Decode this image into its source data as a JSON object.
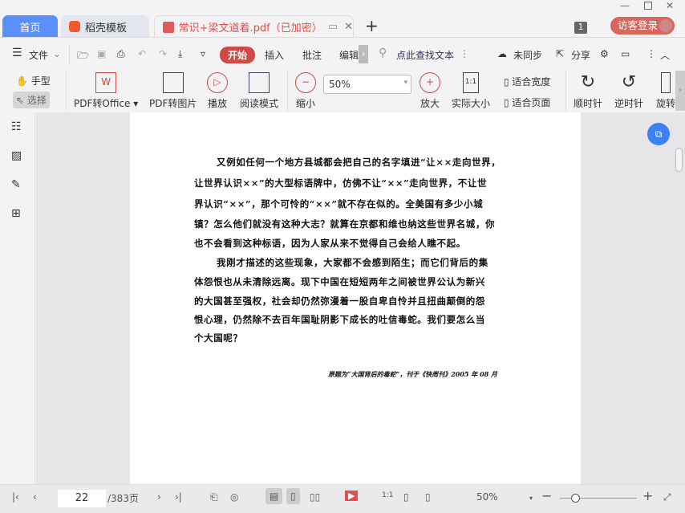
{
  "tabs": [
    {
      "label": "首页"
    },
    {
      "label": "稻壳模板"
    },
    {
      "label": "常识+梁文道着.pdf（已加密）"
    }
  ],
  "window": {
    "tab_count": "1",
    "login": "访客登录"
  },
  "menu": {
    "file": "文件",
    "start": "开始",
    "insert": "插入",
    "annotate": "批注",
    "edit": "编辑",
    "search": "点此查找文本",
    "sync": "未同步",
    "share": "分享"
  },
  "tools": {
    "hand": "手型",
    "select": "选择",
    "pdf_office": "PDF转Office",
    "pdf_image": "PDF转图片",
    "play": "播放",
    "read_mode": "阅读模式",
    "zoom_out": "缩小",
    "zoom_value": "50%",
    "zoom_in": "放大",
    "actual_size": "实际大小",
    "fit_width": "适合宽度",
    "fit_page": "适合页面",
    "clockwise": "顺时针",
    "counterclockwise": "逆时针",
    "rotate": "旋转"
  },
  "doc": {
    "lines": [
      "又例如任何一个地方县城都会把自己的名字填进“让××走向世界，",
      "让世界认识××”的大型标语牌中，仿佛不让“××”走向世界，不让世",
      "界认识“××”，那个可怜的“××”就不存在似的。全美国有多少小城",
      "镇？怎么他们就没有这种大志？就算在京都和维也纳这些世界名城，你",
      "也不会看到这种标语，因为人家从来不觉得自己会给人瞧不起。",
      "我刚才描述的这些现象，大家都不会感到陌生；而它们背后的集",
      "体怨恨也从未清除远离。现下中国在短短两年之间被世界公认为新兴",
      "的大国甚至强权，社会却仍然弥漫着一股自卑自怜并且扭曲颠倒的怨",
      "恨心理，仍然除不去百年国耻阴影下成长的吐信毒蛇。我们要怎么当",
      "个大国呢？"
    ],
    "footnote": "原题为“大国背后的毒蛇”，刊于《快周刊》2005 年 08 月"
  },
  "status": {
    "page": "22",
    "total": "/383页",
    "zoom": "50%",
    "zoom_slider_percent": 20
  },
  "colors": {
    "accent": "#d9534f",
    "home_tab": "#5b8ff9"
  }
}
